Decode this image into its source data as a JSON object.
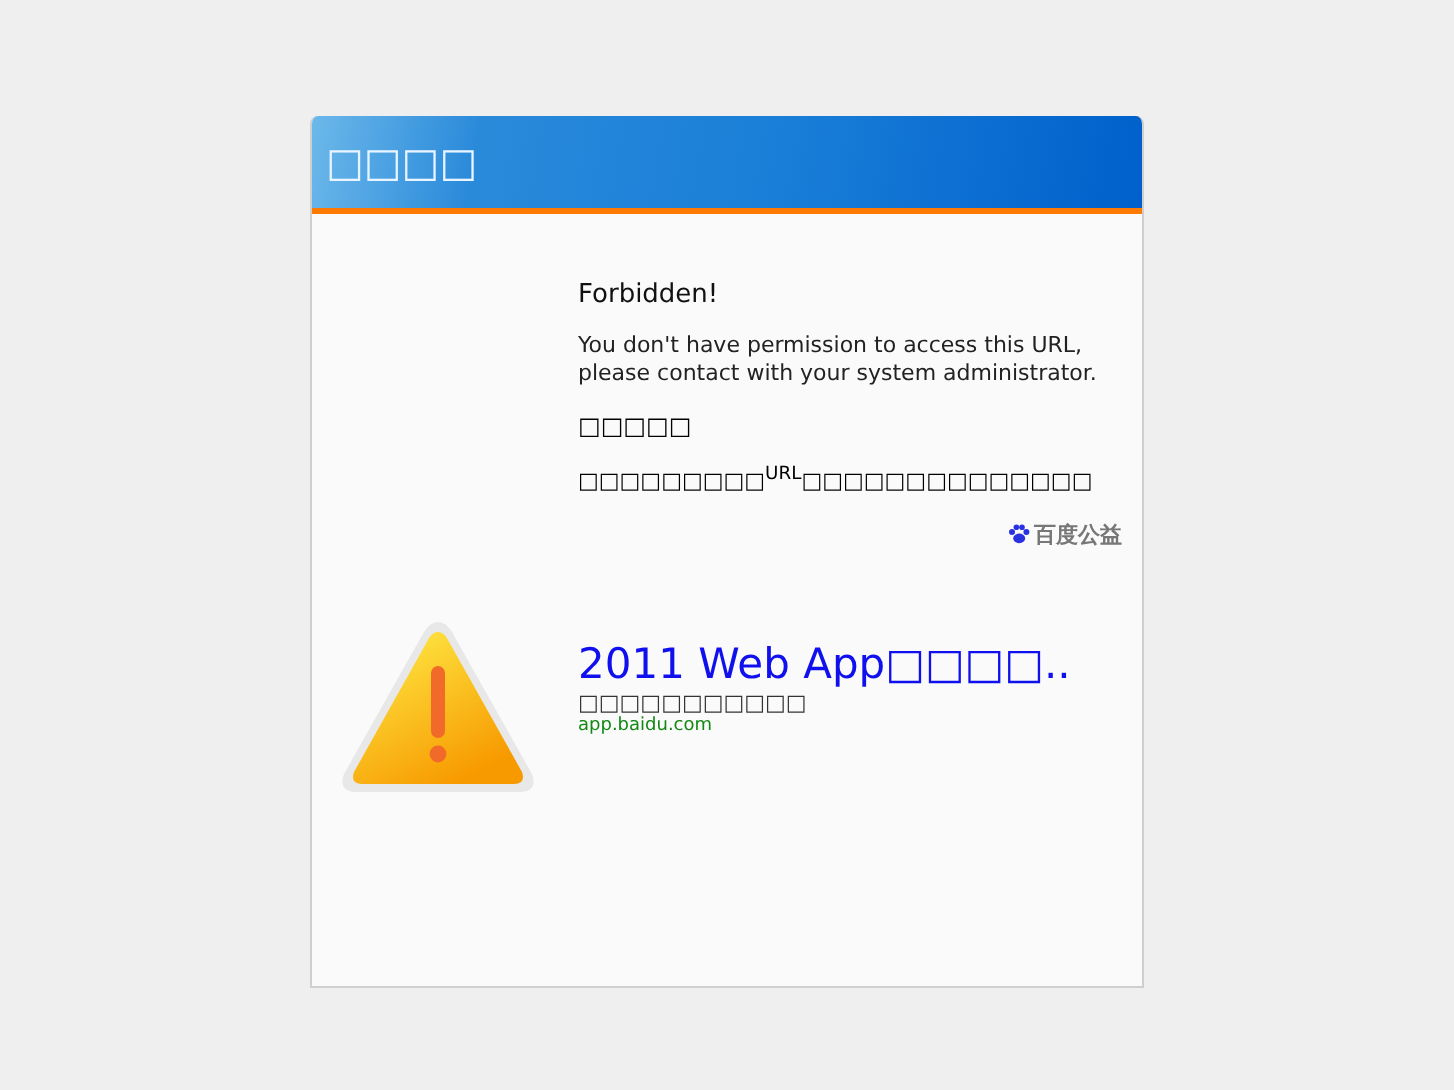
{
  "window": {
    "title": "□□□□"
  },
  "message": {
    "heading": "Forbidden!",
    "text_lines": [
      "You don't have permission to access this URL,",
      "please contact with your system administrator."
    ],
    "cn_heading": "□□□□□",
    "cn_text": "□□□□□□□□□$^{URL}$□□□□□□□□□□□□□□"
  },
  "ad": {
    "logo": "百度公益",
    "title": "2011 Web App□□□□..",
    "description": "□□□□□□□□□□□",
    "url": "app.baidu.com"
  }
}
